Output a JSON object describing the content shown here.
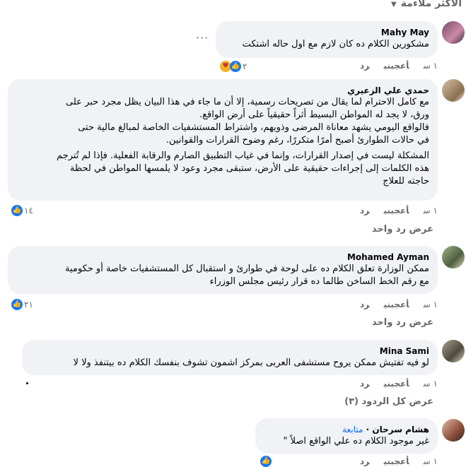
{
  "sort": {
    "label": "الأكثر ملاءمة"
  },
  "comments": [
    {
      "author": "Mahy May",
      "text": "مشكورين الكلام ده كان لازم مع اول حاله اشتكت",
      "time": "١ س",
      "like": "أعجبني",
      "reply": "رد",
      "reactions": "٢",
      "reaction_icons": [
        "like-icon",
        "care-icon"
      ]
    },
    {
      "author": "حمدي علي الزعيري",
      "text_lines": [
        "مع كامل الاحترام لما يقال من تصريحات رسمية، إلا أن ما جاء في هذا البيان يظل مجرد حبر على",
        "ورق، لا يجد له المواطن البسيط أثراً حقيقياً على أرض الواقع.",
        "فالواقع اليومي يشهد معاناة المرضى وذويهم، واشتراط المستشفيات الخاصة لمبالغ مالية حتى",
        "في حالات الطوارئ أصبح أمرًا متكررًا، رغم وضوح القرارات والقوانين."
      ],
      "text_lines_2": [
        "المشكلة ليست في إصدار القرارات، وإنما في غياب التطبيق الصارم والرقابة الفعلية. فإذا لم تُترجم",
        "هذه الكلمات إلى إجراءات حقيقية على الأرض، ستبقى مجرد وعود لا يلمسها المواطن في لحظة",
        "حاجته للعلاج"
      ],
      "time": "١ س",
      "like": "أعجبني",
      "reply": "رد",
      "reactions": "١٤",
      "more_replies": "عرض رد واحد"
    },
    {
      "author": "Mohamed Ayman",
      "text_lines": [
        "ممكن الوزارة تعلق الكلام ده على لوحة في طوارئ و استقبال كل المستشفيات خاصة أو حكومية",
        "مع رقم الخط الساخن طالما ده قرار رئيس مجلس الوزراء"
      ],
      "time": "١ س",
      "like": "أعجبني",
      "reply": "رد",
      "reactions": "٢١",
      "more_replies": "عرض رد واحد"
    },
    {
      "author": "Mina Sami",
      "text": "لو فيه تفتيش ممكن يروح مستشفى العربى بمركز اشمون تشوف بنفسك الكلام ده بيتنفذ ولا لا",
      "time": "١ س",
      "like": "أعجبني",
      "reply": "رد",
      "more_replies": "عرض كل الردود (٣)"
    },
    {
      "author": "هشام سرحان",
      "follow": "متابعة",
      "text": "غير موجود الكلام ده علي الواقع اصلاً \"",
      "time": "١ س",
      "like": "أعجبني",
      "reply": "رد"
    }
  ],
  "colors": {
    "bubble": "#f0f2f5",
    "meta": "#65676b",
    "like_blue": "#1877f2",
    "follow_blue": "#0866ff"
  }
}
